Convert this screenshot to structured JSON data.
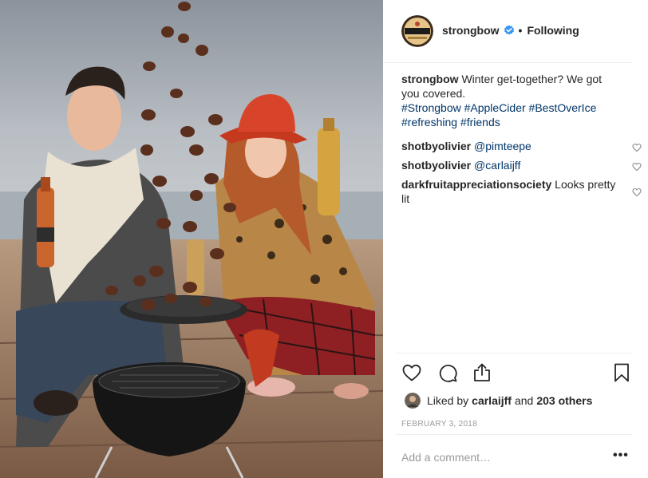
{
  "post": {
    "image_alt": "Friends grilling chestnuts with Strongbow cider",
    "header": {
      "username": "strongbow",
      "verified": true,
      "separator": "•",
      "follow_status": "Following"
    },
    "caption": {
      "username": "strongbow",
      "text": "Winter get-together? We got you covered.",
      "hashtags": "#Strongbow #AppleCider #BestOverIce #refreshing #friends"
    },
    "comments": [
      {
        "username": "shotbyolivier",
        "text": "@pimteepe",
        "is_mention": true
      },
      {
        "username": "shotbyolivier",
        "text": "@carlaijff",
        "is_mention": true
      },
      {
        "username": "darkfruitappreciationsociety",
        "text": "Looks pretty lit",
        "is_mention": false
      }
    ],
    "likes": {
      "prefix": "Liked by",
      "user": "carlaijff",
      "conjunction": "and",
      "others": "203 others"
    },
    "date": "FEBRUARY 3, 2018",
    "add_comment_placeholder": "Add a comment…",
    "more_label": "•••",
    "icons": {
      "like": "heart-icon",
      "comment": "comment-icon",
      "share": "share-icon",
      "save": "bookmark-icon",
      "verified": "verified-badge-icon"
    },
    "colors": {
      "link": "#003569",
      "verified": "#3897f0",
      "muted": "#999999",
      "text": "#262626"
    }
  }
}
